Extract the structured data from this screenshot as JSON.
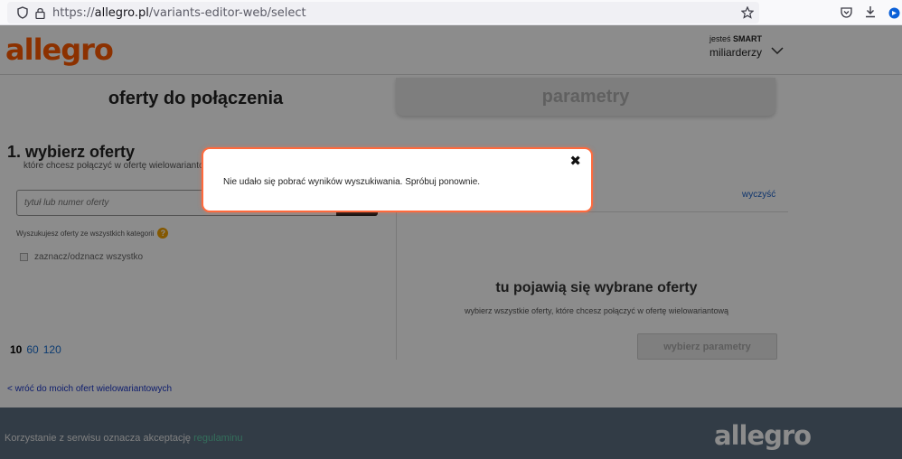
{
  "browser": {
    "url_prefix": "https://",
    "url_domain": "allegro.pl",
    "url_path": "/variants-editor-web/select"
  },
  "header": {
    "logo": "allegro",
    "smart_prefix": "jesteś ",
    "smart_label": "SMART",
    "username": "miliarderzy"
  },
  "tabs": {
    "left": "oferty do połączenia",
    "right": "parametry"
  },
  "step": {
    "title": "1. wybierz oferty",
    "subtitle": "które chcesz połączyć w ofertę wielowariantową"
  },
  "search": {
    "placeholder": "tytuł lub numer oferty"
  },
  "category_note": "Wyszukujesz oferty ze wszystkich kategorii",
  "select_all": "zaznacz/odznacz wszystko",
  "selected_panel": {
    "clear": "wyczyść",
    "empty_title": "tu pojawią się wybrane oferty",
    "empty_subtitle": "wybierz wszystkie oferty, które chcesz połączyć w ofertę wielowariantową",
    "params_button": "wybierz parametry"
  },
  "page_sizes": {
    "current": "10",
    "options": [
      "60",
      "120"
    ]
  },
  "back_link": "< wróć do moich ofert wielowariantowych",
  "footer": {
    "text": "Korzystanie z serwisu oznacza akceptację ",
    "link": "regulaminu",
    "logo": "allegro"
  },
  "modal": {
    "message": "Nie udało się pobrać wyników wyszukiwania. Spróbuj ponownie.",
    "close": "✖"
  },
  "colors": {
    "modal_border": "#ff6a3d",
    "footer_bg": "#5b6e80",
    "link": "#1a6fd0"
  }
}
